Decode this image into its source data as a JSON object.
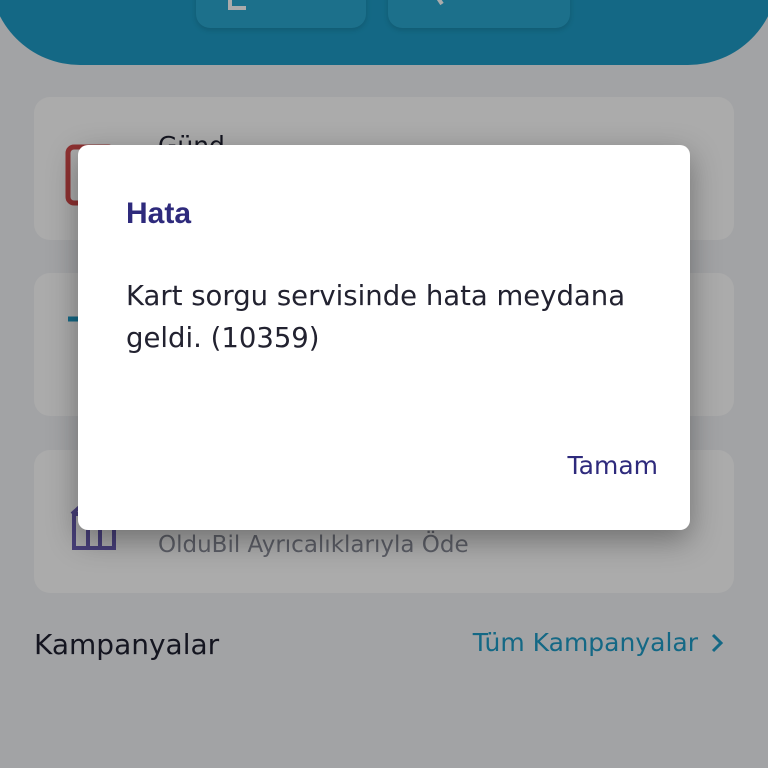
{
  "background": {
    "cards": [
      {
        "title": "Günd",
        "subtitle": ""
      },
      {
        "title": "",
        "subtitle": ""
      },
      {
        "title": "",
        "subtitle": "OlduBil Ayrıcalıklarıyla Öde"
      }
    ],
    "campaigns": {
      "title": "Kampanyalar",
      "link": "Tüm Kampanyalar"
    }
  },
  "dialog": {
    "title": "Hata",
    "message": "Kart sorgu servisinde hata meydana geldi. (10359)",
    "ok_label": "Tamam"
  },
  "colors": {
    "accent": "#1e9cc6",
    "dialog_text": "#2e2a7c",
    "overlay": "rgba(0,0,0,0.33)"
  }
}
